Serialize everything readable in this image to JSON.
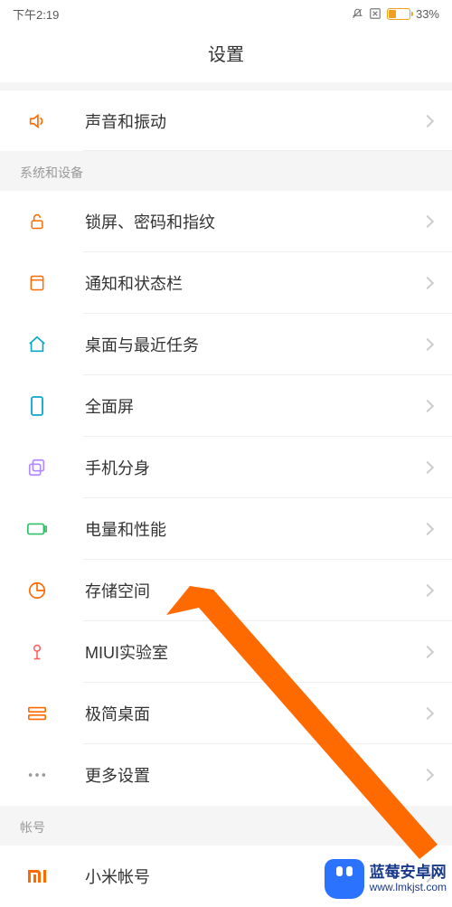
{
  "status": {
    "time": "下午2:19",
    "battery_percent": "33%"
  },
  "header": {
    "title": "设置"
  },
  "top_row": {
    "label": "声音和振动"
  },
  "section1": {
    "title": "系统和设备",
    "items": [
      {
        "label": "锁屏、密码和指纹"
      },
      {
        "label": "通知和状态栏"
      },
      {
        "label": "桌面与最近任务"
      },
      {
        "label": "全面屏"
      },
      {
        "label": "手机分身"
      },
      {
        "label": "电量和性能"
      },
      {
        "label": "存储空间"
      },
      {
        "label": "MIUI实验室"
      },
      {
        "label": "极简桌面"
      },
      {
        "label": "更多设置"
      }
    ]
  },
  "section2": {
    "title": "帐号",
    "items": [
      {
        "label": "小米帐号"
      }
    ]
  },
  "watermark": {
    "title": "蓝莓安卓网",
    "url": "www.lmkjst.com"
  }
}
